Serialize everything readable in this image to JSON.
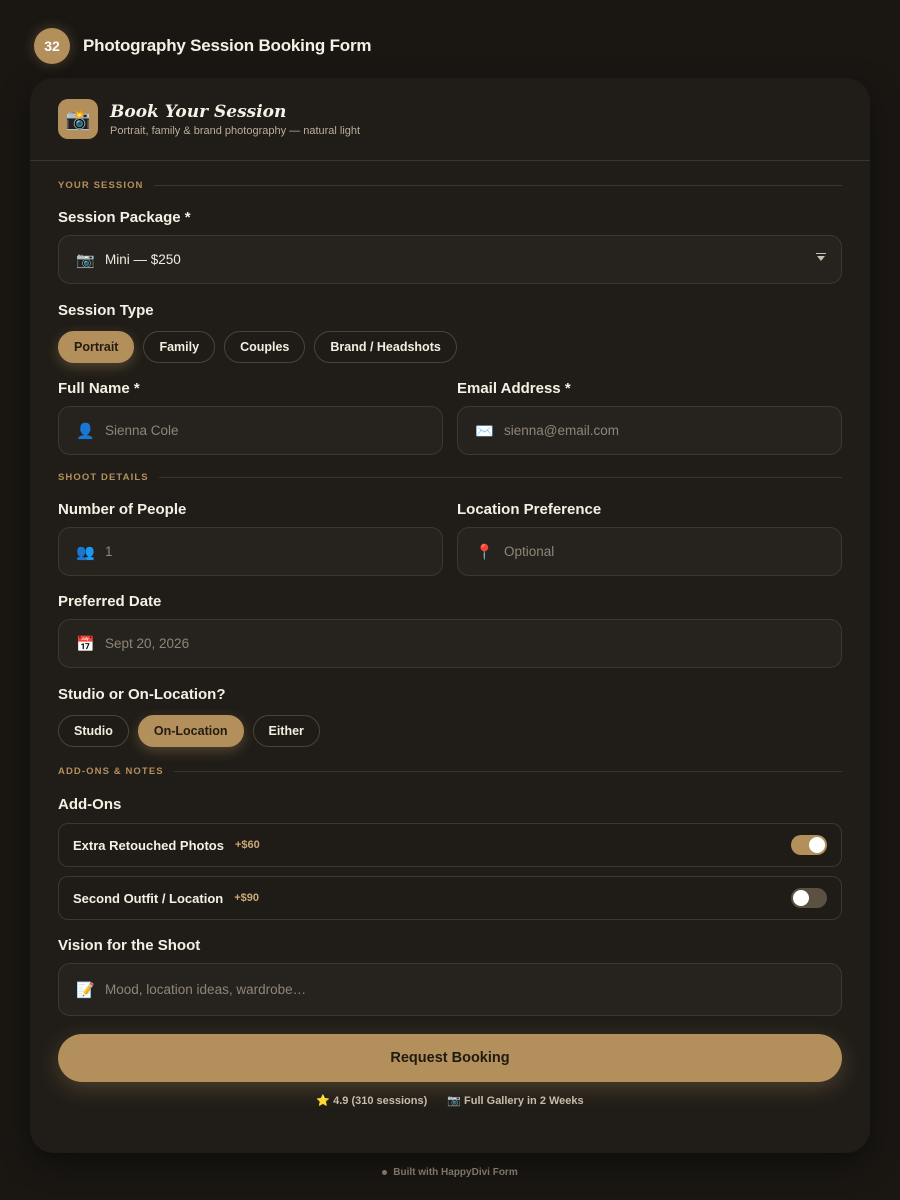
{
  "header": {
    "badge_number": "32",
    "title": "Photography Session Booking Form"
  },
  "form": {
    "icon": "camera-flash-icon",
    "title": "Book Your Session",
    "subtitle": "Portrait, family & brand photography — natural light"
  },
  "sections": {
    "session": "YOUR SESSION",
    "shoot": "SHOOT DETAILS",
    "addons": "ADD-ONS & NOTES"
  },
  "package": {
    "label": "Session Package *",
    "value": "Mini — $250",
    "icon": "camera-icon"
  },
  "session_type": {
    "label": "Session Type",
    "options": [
      "Portrait",
      "Family",
      "Couples",
      "Brand / Headshots"
    ],
    "selected": "Portrait"
  },
  "full_name": {
    "label": "Full Name *",
    "placeholder": "Sienna Cole",
    "icon": "user-icon"
  },
  "email": {
    "label": "Email Address *",
    "placeholder": "sienna@email.com",
    "icon": "envelope-icon"
  },
  "people": {
    "label": "Number of People",
    "placeholder": "1",
    "icon": "people-icon"
  },
  "location": {
    "label": "Location Preference",
    "placeholder": "Optional",
    "icon": "pin-icon"
  },
  "date": {
    "label": "Preferred Date",
    "placeholder": "Sept 20, 2026",
    "icon": "calendar-icon"
  },
  "venue": {
    "label": "Studio or On-Location?",
    "options": [
      "Studio",
      "On-Location",
      "Either"
    ],
    "selected": "On-Location"
  },
  "addons": {
    "label": "Add-Ons",
    "items": [
      {
        "name": "Extra Retouched Photos",
        "price": "+$60",
        "enabled": true
      },
      {
        "name": "Second Outfit / Location",
        "price": "+$90",
        "enabled": false
      }
    ]
  },
  "vision": {
    "label": "Vision for the Shoot",
    "placeholder": "Mood, location ideas, wardrobe…",
    "icon": "memo-icon"
  },
  "submit_label": "Request Booking",
  "trust": {
    "rating": "4.9 (310 sessions)",
    "gallery": "Full Gallery in 2 Weeks"
  },
  "footer": "Built with HappyDivi Form",
  "colors": {
    "accent": "#b38f5c",
    "background": "#1a1713",
    "card": "#201d18"
  }
}
